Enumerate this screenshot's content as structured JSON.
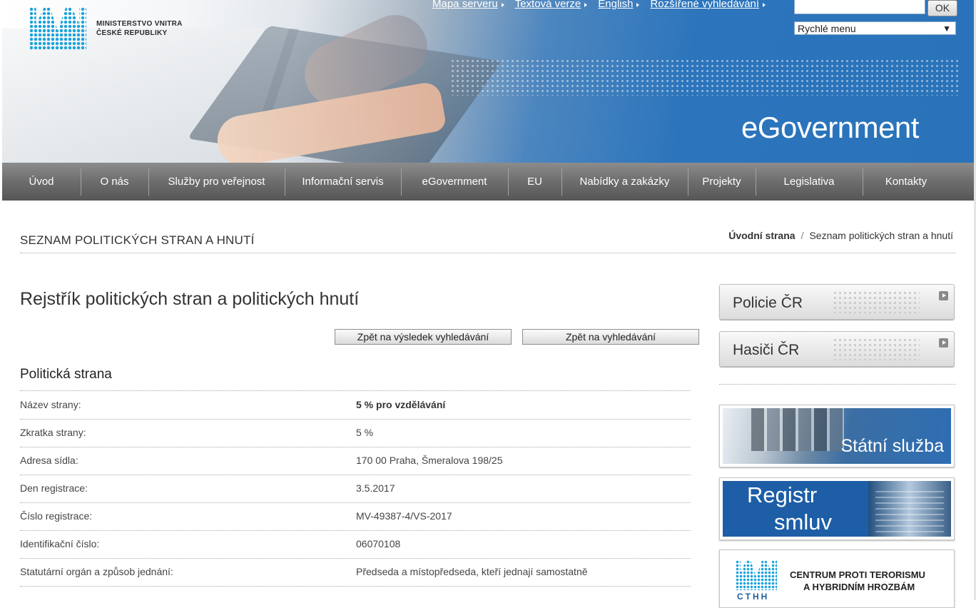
{
  "header": {
    "logo_line1": "MINISTERSTVO VNITRA",
    "logo_line2": "ČESKÉ REPUBLIKY",
    "top_links": [
      "Mapa serveru",
      "Textová verze",
      "English",
      "Rozšířené vyhledávání"
    ],
    "search_value": "",
    "ok_label": "OK",
    "quick_menu_selected": "Rychlé menu",
    "banner_title": "eGovernment"
  },
  "nav": {
    "items": [
      "Úvod",
      "O nás",
      "Služby pro veřejnost",
      "Informační servis",
      "eGovernment",
      "EU",
      "Nabídky a zakázky",
      "Projekty",
      "Legislativa",
      "Kontakty"
    ]
  },
  "page": {
    "section_title": "SEZNAM POLITICKÝCH STRAN A HNUTÍ",
    "breadcrumb": {
      "home": "Úvodní strana",
      "separator": "/",
      "current": "Seznam politických stran a hnutí"
    },
    "main_title": "Rejstřík politických stran a politických hnutí",
    "back_to_results": "Zpět na výsledek vyhledávání",
    "back_to_search": "Zpět na vyhledávání",
    "subtitle": "Politická strana",
    "rows": [
      {
        "label": "Název strany:",
        "value": "5 % pro vzdělávání"
      },
      {
        "label": "Zkratka strany:",
        "value": "5 %"
      },
      {
        "label": "Adresa sídla:",
        "value": "170 00 Praha, Šmeralova 198/25"
      },
      {
        "label": "Den registrace:",
        "value": "3.5.2017"
      },
      {
        "label": "Číslo registrace:",
        "value": "MV-49387-4/VS-2017"
      },
      {
        "label": "Identifikační číslo:",
        "value": "06070108"
      },
      {
        "label": "Statutární orgán a způsob jednání:",
        "value": "Předseda a místopředseda, kteří jednají samostatně"
      }
    ]
  },
  "sidebar": {
    "policie": "Policie ČR",
    "hasici": "Hasiči ČR",
    "statni_sluzba": "Státní služba",
    "registr_line1": "Registr",
    "registr_line2": "smluv",
    "cthh_abbr": "CTHH",
    "cthh_line1": "CENTRUM PROTI TERORISMU",
    "cthh_line2": "A HYBRIDNÍM HROZBÁM"
  },
  "colors": {
    "header_blue": "#2a73ba",
    "nav_gray": "#6d6d6d",
    "logo_cyan": "#1aa3dc"
  }
}
